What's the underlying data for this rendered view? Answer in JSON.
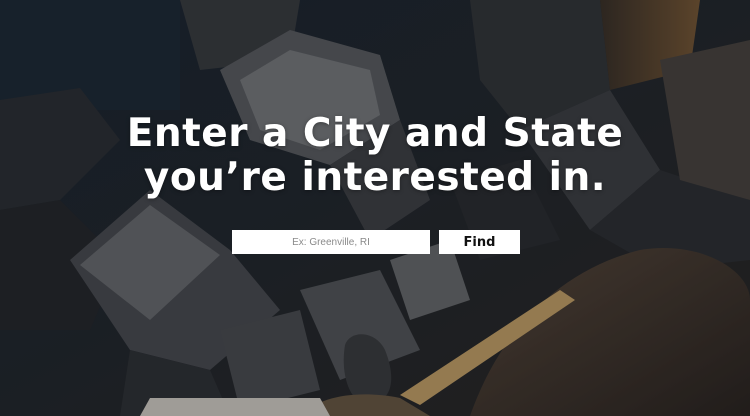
{
  "hero": {
    "headline_line1": "Enter a City and State",
    "headline_line2": "you’re interested in."
  },
  "search": {
    "placeholder": "Ex: Greenville, RI",
    "value": "",
    "button_label": "Find"
  },
  "colors": {
    "text": "#ffffff",
    "input_background": "#ffffff",
    "button_background": "#ffffff",
    "button_text": "#111111"
  }
}
